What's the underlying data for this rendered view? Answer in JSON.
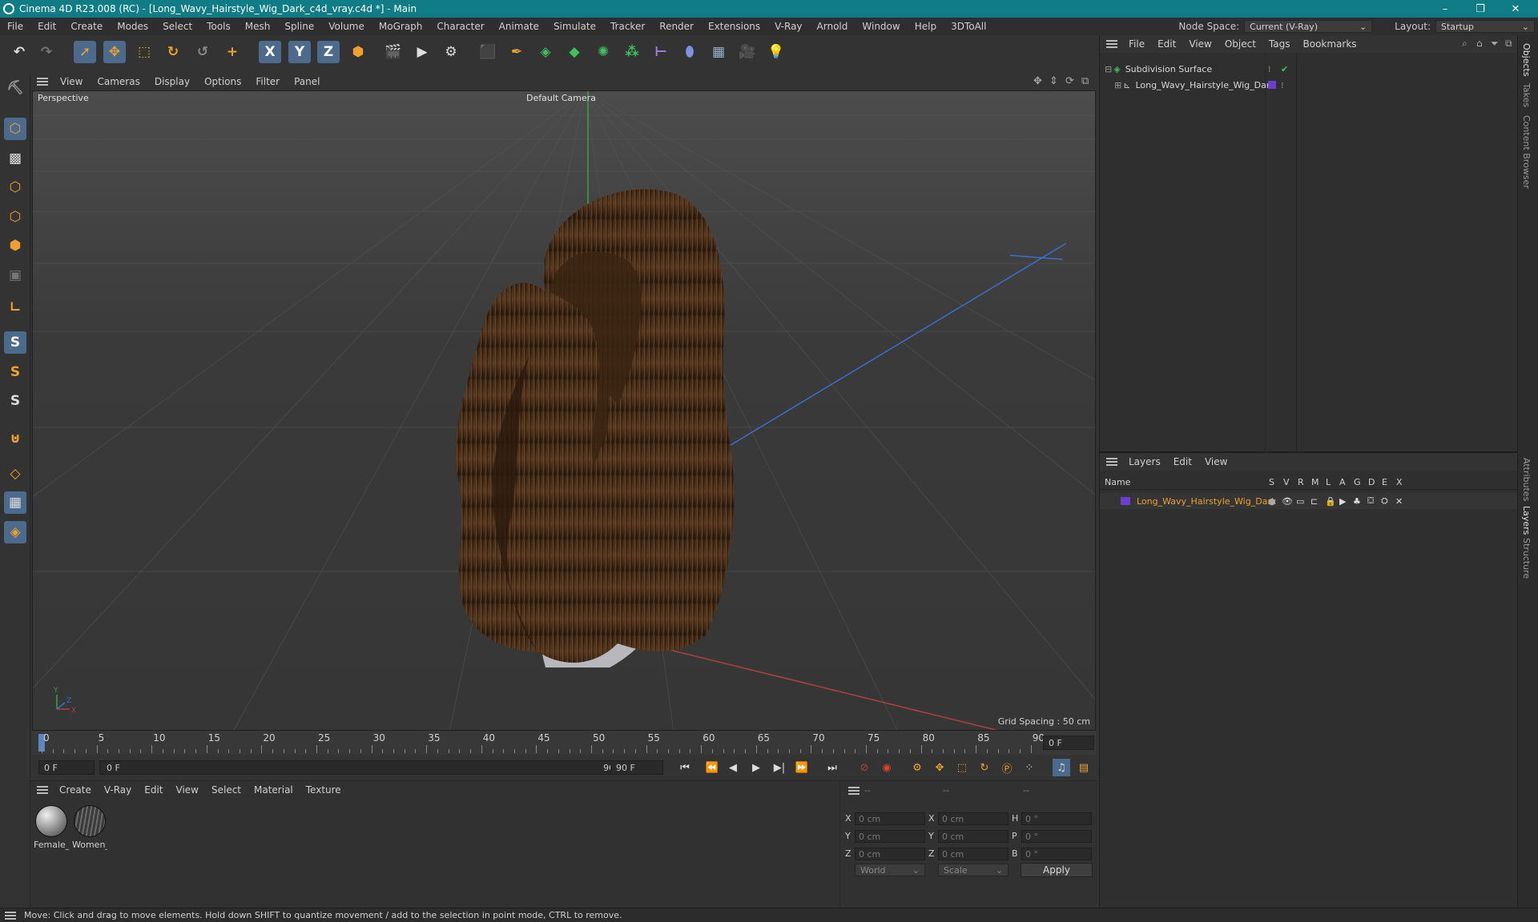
{
  "window": {
    "title": "Cinema 4D R23.008 (RC) - [Long_Wavy_Hairstyle_Wig_Dark_c4d_vray.c4d *] - Main",
    "controls": [
      "–",
      "❐",
      "✕"
    ]
  },
  "menubar": {
    "items": [
      "File",
      "Edit",
      "Create",
      "Modes",
      "Select",
      "Tools",
      "Mesh",
      "Spline",
      "Volume",
      "MoGraph",
      "Character",
      "Animate",
      "Simulate",
      "Tracker",
      "Render",
      "Extensions",
      "V-Ray",
      "Arnold",
      "Window",
      "Help",
      "3DToAll"
    ],
    "node_space_label": "Node Space:",
    "node_space_value": "Current (V-Ray)",
    "layout_label": "Layout:",
    "layout_value": "Startup"
  },
  "toolbar": {
    "axis_x": "X",
    "axis_y": "Y",
    "axis_z": "Z"
  },
  "left_tools": {
    "s1": "S",
    "s2": "S",
    "s3": "S"
  },
  "viewport": {
    "menu": [
      "View",
      "Cameras",
      "Display",
      "Options",
      "Filter",
      "Panel"
    ],
    "label": "Perspective",
    "camera": "Default Camera",
    "grid_spacing": "Grid Spacing : 50 cm",
    "axis_x": "X",
    "axis_y": "Y",
    "axis_z": "Z"
  },
  "timeline": {
    "ticks": [
      "0",
      "5",
      "10",
      "15",
      "20",
      "25",
      "30",
      "35",
      "40",
      "45",
      "50",
      "55",
      "60",
      "65",
      "70",
      "75",
      "80",
      "85",
      "90"
    ],
    "current_frame": "0 F",
    "start_field": "0 F",
    "range_start": "0 F",
    "range_end": "90 F",
    "end_field": "90 F"
  },
  "materials": {
    "menu": [
      "Create",
      "V-Ray",
      "Edit",
      "View",
      "Select",
      "Material",
      "Texture"
    ],
    "items": [
      {
        "name": "Female_l"
      },
      {
        "name": "Women_"
      }
    ]
  },
  "attributes": {
    "header": [
      "--",
      "--",
      "--"
    ],
    "rows": [
      {
        "l1": "X",
        "v1": "0 cm",
        "l2": "X",
        "v2": "0 cm",
        "l3": "H",
        "v3": "0 °"
      },
      {
        "l1": "Y",
        "v1": "0 cm",
        "l2": "Y",
        "v2": "0 cm",
        "l3": "P",
        "v3": "0 °"
      },
      {
        "l1": "Z",
        "v1": "0 cm",
        "l2": "Z",
        "v2": "0 cm",
        "l3": "B",
        "v3": "0 °"
      }
    ],
    "coord_mode": "World",
    "size_mode": "Scale",
    "apply_label": "Apply"
  },
  "objects": {
    "menu": [
      "File",
      "Edit",
      "View",
      "Object",
      "Tags",
      "Bookmarks"
    ],
    "items": [
      {
        "name": "Subdivision Surface"
      },
      {
        "name": "Long_Wavy_Hairstyle_Wig_Dark"
      }
    ]
  },
  "layers": {
    "menu": [
      "Layers",
      "Edit",
      "View"
    ],
    "columns": [
      "Name",
      "S",
      "V",
      "R",
      "M",
      "L",
      "A",
      "G",
      "D",
      "E",
      "X"
    ],
    "items": [
      {
        "name": "Long_Wavy_Hairstyle_Wig_Dark",
        "color": "#6b3fd1"
      }
    ]
  },
  "side_tabs": [
    "Objects",
    "Takes",
    "Content Browser",
    "Attributes",
    "Layers",
    "Structure"
  ],
  "status": {
    "text": "Move: Click and drag to move elements. Hold down SHIFT to quantize movement / add to the selection in point mode, CTRL to remove."
  },
  "colors": {
    "titlebar": "#0f7c86",
    "accent_orange": "#f0a030",
    "layer_purple": "#6b3fd1",
    "hair_brown": "#4a2f1a"
  }
}
